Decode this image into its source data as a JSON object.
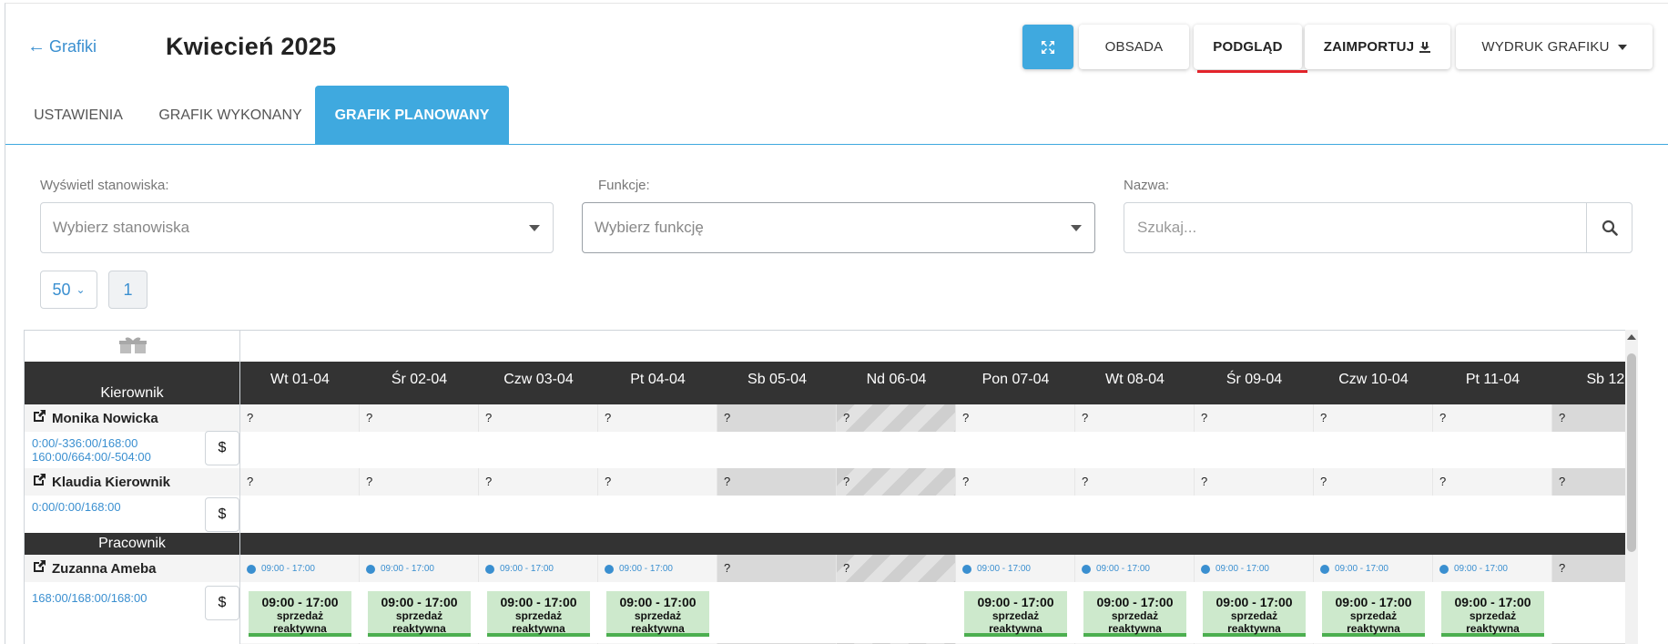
{
  "header": {
    "back_label": "Grafiki",
    "title": "Kwiecień 2025",
    "buttons": {
      "obsada": "OBSADA",
      "podglad": "PODGLĄD",
      "zaimportuj": "ZAIMPORTUJ",
      "wydruk": "WYDRUK GRAFIKU"
    }
  },
  "tabs": [
    {
      "label": "USTAWIENIA",
      "active": false
    },
    {
      "label": "GRAFIK WYKONANY",
      "active": false
    },
    {
      "label": "GRAFIK PLANOWANY",
      "active": true
    }
  ],
  "filters": {
    "stanowiska": {
      "label": "Wyświetl stanowiska:",
      "placeholder": "Wybierz stanowiska"
    },
    "funkcje": {
      "label": "Funkcje:",
      "placeholder": "Wybierz funkcję"
    },
    "nazwa": {
      "label": "Nazwa:",
      "placeholder": "Szukaj..."
    }
  },
  "pagination": {
    "per_page": "50",
    "current_page": "1"
  },
  "schedule": {
    "days": [
      "Wt 01-04",
      "Śr 02-04",
      "Czw 03-04",
      "Pt 04-04",
      "Sb 05-04",
      "Nd 06-04",
      "Pon 07-04",
      "Wt 08-04",
      "Śr 09-04",
      "Czw 10-04",
      "Pt 11-04",
      "Sb 12-0"
    ],
    "sections": [
      {
        "name": "Kierownik",
        "employees": [
          {
            "name": "Monika Nowicka",
            "hours_line1": "0:00/-336:00/168:00",
            "hours_line2": "160:00/664:00/-504:00",
            "dollar": "$",
            "cell_mark": "?"
          },
          {
            "name": "Klaudia Kierownik",
            "hours_line1": "0:00/0:00/168:00",
            "hours_line2": "",
            "dollar": "$",
            "cell_mark": "?"
          }
        ]
      },
      {
        "name": "Pracownik",
        "employees": [
          {
            "name": "Zuzanna Ameba",
            "hours_line1": "168:00/168:00/168:00",
            "dollar": "$",
            "cell_mark": "?",
            "summary_time": "09:00 - 17:00",
            "shift": {
              "time": "09:00 - 17:00",
              "function_line1": "sprzedaż",
              "function_line2": "reaktywna"
            }
          }
        ]
      }
    ]
  }
}
